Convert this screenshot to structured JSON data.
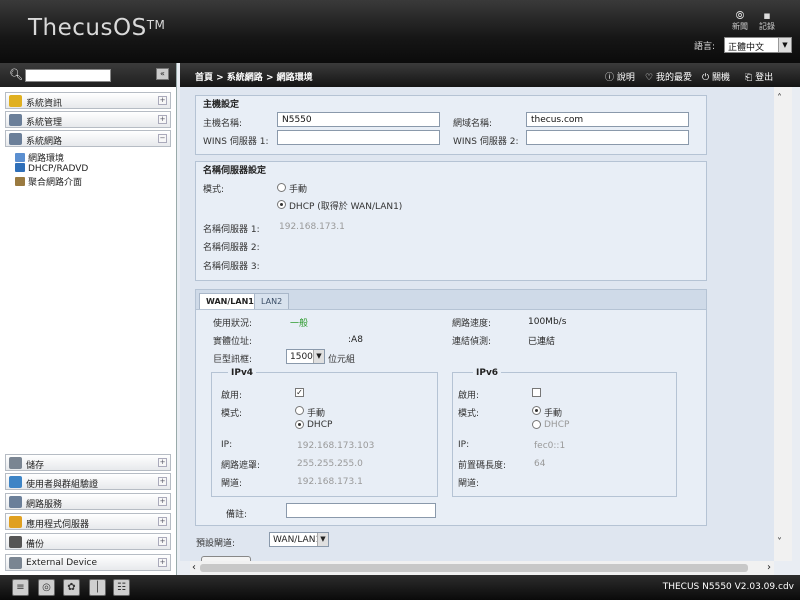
{
  "header": {
    "logo": "ThecusOS",
    "logo_tm": "TM",
    "news_label": "新聞",
    "log_label": "記錄",
    "language_label": "語言:",
    "language_value": "正體中文"
  },
  "sidebar": {
    "search_placeholder": "",
    "categories_top": [
      {
        "label": "系統資訊",
        "icon_color": "#e0b020",
        "toggle": "+"
      },
      {
        "label": "系統管理",
        "icon_color": "#6b7f99",
        "toggle": "+"
      },
      {
        "label": "系統網路",
        "icon_color": "#6b7f99",
        "toggle": "−"
      }
    ],
    "subitems": [
      {
        "label": "網路環境",
        "icon_color": "#5b8fd0"
      },
      {
        "label": "DHCP/RADVD",
        "icon_color": "#2f6fb8"
      },
      {
        "label": "聚合網路介面",
        "icon_color": "#9a7a40"
      }
    ],
    "categories_bottom": [
      {
        "label": "儲存",
        "icon_color": "#7a8592",
        "toggle": "+"
      },
      {
        "label": "使用者與群組驗證",
        "icon_color": "#3d84c6",
        "toggle": "+"
      },
      {
        "label": "網路服務",
        "icon_color": "#6b7f99",
        "toggle": "+"
      },
      {
        "label": "應用程式伺服器",
        "icon_color": "#e0a020",
        "toggle": "+"
      },
      {
        "label": "備份",
        "icon_color": "#555",
        "toggle": "+"
      },
      {
        "label": "External Device",
        "icon_color": "#7a8592",
        "toggle": "+"
      }
    ]
  },
  "mainbar": {
    "breadcrumb": "首頁 > 系統網路 > 網路環境",
    "help": "說明",
    "favorites": "我的最愛",
    "shutdown": "關機",
    "logout": "登出"
  },
  "host": {
    "legend": "主機設定",
    "hostname_label": "主機名稱:",
    "hostname_value": "N5550",
    "domain_label": "網域名稱:",
    "domain_value": "thecus.com",
    "wins1_label": "WINS 伺服器 1:",
    "wins1_value": "",
    "wins2_label": "WINS 伺服器 2:",
    "wins2_value": ""
  },
  "dns": {
    "legend": "名稱伺服器設定",
    "mode_label": "模式:",
    "manual_label": "手動",
    "dhcp_label": "DHCP (取得於 WAN/LAN1)",
    "dns1_label": "名稱伺服器 1:",
    "dns1_value": "192.168.173.1",
    "dns2_label": "名稱伺服器 2:",
    "dns2_value": "",
    "dns3_label": "名稱伺服器 3:",
    "dns3_value": ""
  },
  "tabs": [
    "WAN/LAN1",
    "LAN2"
  ],
  "wan": {
    "status_label": "使用狀況:",
    "status_value": "一般",
    "speed_label": "網路速度:",
    "speed_value": "100Mb/s",
    "mac_label": "實體位址:",
    "mac_value": ":A8",
    "link_label": "連結偵測:",
    "link_value": "已連結",
    "jumbo_label": "巨型訊框:",
    "jumbo_value": "1500",
    "jumbo_unit": "位元組",
    "ipv4": {
      "legend": "IPv4",
      "enable_label": "啟用:",
      "enable_mark": "✓",
      "mode_label": "模式:",
      "manual_label": "手動",
      "dhcp_label": "DHCP",
      "ip_label": "IP:",
      "ip_value": "192.168.173.103",
      "netmask_label": "網路遮罩:",
      "netmask_value": "255.255.255.0",
      "gateway_label": "閘道:",
      "gateway_value": "192.168.173.1"
    },
    "ipv6": {
      "legend": "IPv6",
      "enable_label": "啟用:",
      "mode_label": "模式:",
      "manual_label": "手動",
      "dhcp_label": "DHCP",
      "ip_label": "IP:",
      "ip_value": "fec0::1",
      "prefix_label": "前置碼長度:",
      "prefix_value": "64",
      "gateway_label": "閘道:",
      "gateway_value": ""
    },
    "note_label": "備註:",
    "note_value": ""
  },
  "default_gateway": {
    "label": "預設閘道:",
    "value": "WAN/LAN1"
  },
  "footer": {
    "version": "THECUS N5550 V2.03.09.cdv"
  }
}
